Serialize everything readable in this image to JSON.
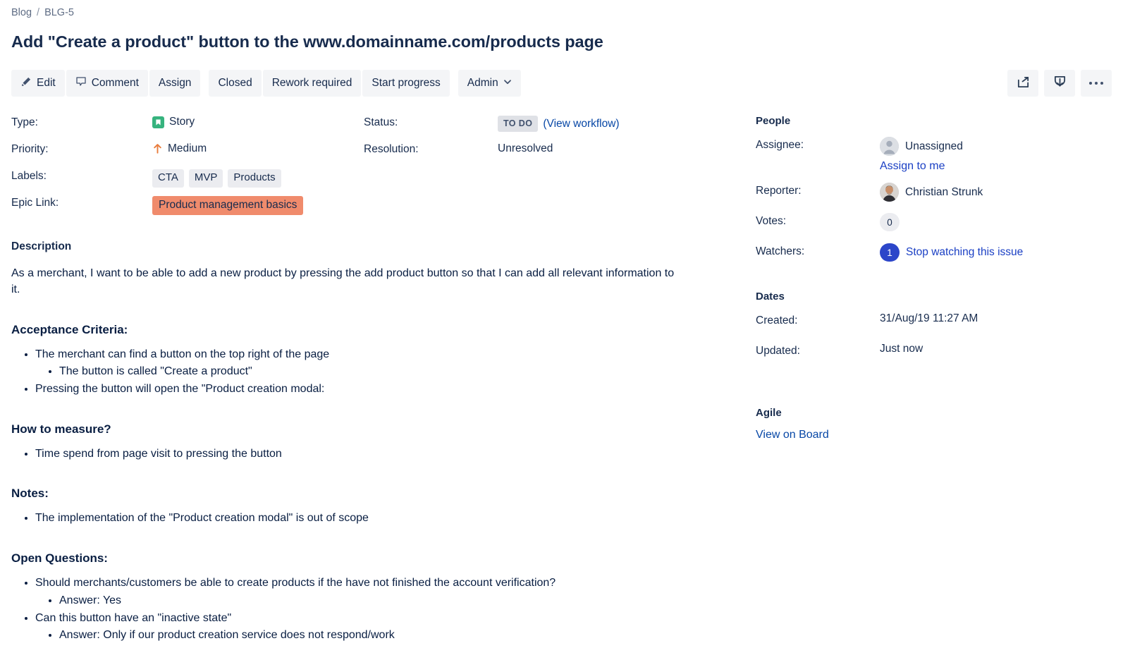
{
  "breadcrumb": {
    "project": "Blog",
    "separator": "/",
    "issue_key": "BLG-5"
  },
  "issue": {
    "title": "Add \"Create a product\" button to the www.domainname.com/products page"
  },
  "toolbar": {
    "edit_label": "Edit",
    "comment_label": "Comment",
    "assign_label": "Assign",
    "closed_label": "Closed",
    "rework_label": "Rework required",
    "start_progress_label": "Start progress",
    "admin_label": "Admin",
    "admin_caret": "⌄",
    "share_icon": "share-icon",
    "export_icon": "export-icon",
    "more_icon": "more-options-icon"
  },
  "details": {
    "type_label": "Type:",
    "type_value": "Story",
    "priority_label": "Priority:",
    "priority_value": "Medium",
    "labels_label": "Labels:",
    "labels": [
      "CTA",
      "MVP",
      "Products"
    ],
    "epic_label": "Epic Link:",
    "epic_value": "Product management basics",
    "status_label": "Status:",
    "status_value": "TO DO",
    "view_workflow": "(View workflow)",
    "resolution_label": "Resolution:",
    "resolution_value": "Unresolved"
  },
  "description": {
    "heading": "Description",
    "paragraph": "As a merchant, I want to be able to add a new product by pressing the add product button so that I can add all relevant information to it.",
    "sections": [
      {
        "heading": "Acceptance Criteria:",
        "items": [
          {
            "text": "The merchant can find a button on the top right of the page",
            "children": [
              "The button is called \"Create a product\""
            ]
          },
          {
            "text": "Pressing the button will open the \"Product creation modal:",
            "children": []
          }
        ]
      },
      {
        "heading": "How to measure?",
        "items": [
          {
            "text": "Time spend from page visit to pressing the button",
            "children": []
          }
        ]
      },
      {
        "heading": "Notes:",
        "items": [
          {
            "text": "The implementation of the \"Product creation modal\" is out of scope",
            "children": []
          }
        ]
      },
      {
        "heading": "Open Questions:",
        "items": [
          {
            "text": "Should merchants/customers be able to create products if the have not finished the account verification?",
            "children": [
              "Answer: Yes"
            ]
          },
          {
            "text": "Can this button have an \"inactive state\"",
            "children": [
              "Answer: Only if our product creation service does not respond/work"
            ]
          }
        ]
      }
    ]
  },
  "sidebar": {
    "people_heading": "People",
    "assignee_label": "Assignee:",
    "assignee_value": "Unassigned",
    "assign_to_me": "Assign to me",
    "reporter_label": "Reporter:",
    "reporter_value": "Christian Strunk",
    "votes_label": "Votes:",
    "votes_value": "0",
    "watchers_label": "Watchers:",
    "watchers_value": "1",
    "watchers_action": "Stop watching this issue",
    "dates_heading": "Dates",
    "created_label": "Created:",
    "created_value": "31/Aug/19 11:27 AM",
    "updated_label": "Updated:",
    "updated_value": "Just now",
    "agile_heading": "Agile",
    "view_on_board": "View on Board"
  },
  "colors": {
    "story_green": "#36B37E",
    "priority_orange": "#E97C3C",
    "epic_salmon": "#F08B6C",
    "status_gray": "#DFE1E6",
    "link_blue": "#0747A6",
    "watcher_blue": "#2C46C9",
    "button_bg": "#F4F5F7"
  }
}
